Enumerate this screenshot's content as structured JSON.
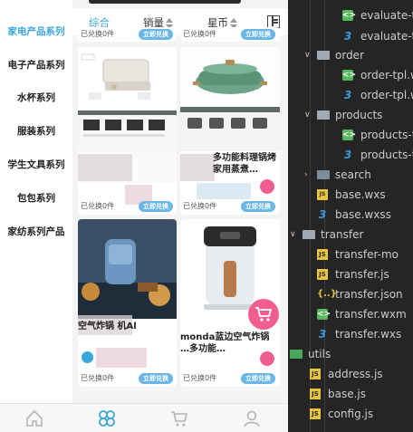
{
  "app": {
    "categories": [
      {
        "label": "家电产品系列",
        "active": true
      },
      {
        "label": "电子产品系列",
        "active": false
      },
      {
        "label": "水杯系列",
        "active": false
      },
      {
        "label": "服装系列",
        "active": false
      },
      {
        "label": "学生文具系列",
        "active": false
      },
      {
        "label": "包包系列",
        "active": false
      },
      {
        "label": "家纺系列产品",
        "active": false
      }
    ],
    "sort": {
      "overall": "综合",
      "sales": "销量",
      "coins": "星币"
    },
    "cards": [
      {
        "name": "",
        "sold": "已兑换0件",
        "button": "立即兑换"
      },
      {
        "name": "",
        "sold": "已兑换0件",
        "button": "立即兑换"
      },
      {
        "name": "",
        "sold": "已兑换0件",
        "button": "立即兑换"
      },
      {
        "name": "多功能料理锅烤 家用蒸煮…",
        "sold": "已兑换0件",
        "button": "立即兑换"
      },
      {
        "name": "空气炸锅 机Al",
        "sold": "已兑换0件",
        "button": "立即兑换"
      },
      {
        "name": "monda蓝边空气炸锅 …多功能…",
        "sold": "已兑换0件",
        "button": "立即兑换"
      }
    ],
    "tabs": [
      "home",
      "category",
      "cart",
      "profile"
    ]
  },
  "explorer": {
    "items": [
      {
        "label": "evaluate-t",
        "type": "wxml"
      },
      {
        "label": "evaluate-t",
        "type": "css"
      },
      {
        "label": "order",
        "type": "folder-open"
      },
      {
        "label": "order-tpl.w",
        "type": "wxml"
      },
      {
        "label": "order-tpl.w",
        "type": "css"
      },
      {
        "label": "products",
        "type": "folder-open"
      },
      {
        "label": "products-t",
        "type": "wxml"
      },
      {
        "label": "products-t",
        "type": "css"
      },
      {
        "label": "search",
        "type": "folder"
      },
      {
        "label": "base.wxs",
        "type": "wxs"
      },
      {
        "label": "base.wxss",
        "type": "css"
      },
      {
        "label": "transfer",
        "type": "folder-open"
      },
      {
        "label": "transfer-mo",
        "type": "js"
      },
      {
        "label": "transfer.js",
        "type": "js"
      },
      {
        "label": "transfer.json",
        "type": "json"
      },
      {
        "label": "transfer.wxm",
        "type": "wxml"
      },
      {
        "label": "transfer.wxs",
        "type": "css"
      },
      {
        "label": "utils",
        "type": "folder-green"
      },
      {
        "label": "address.js",
        "type": "js"
      },
      {
        "label": "base.js",
        "type": "js"
      },
      {
        "label": "config.js",
        "type": "js"
      }
    ],
    "colors": {
      "background": "#252526",
      "text": "#cccccc",
      "accent": "#3aa7dc"
    }
  }
}
